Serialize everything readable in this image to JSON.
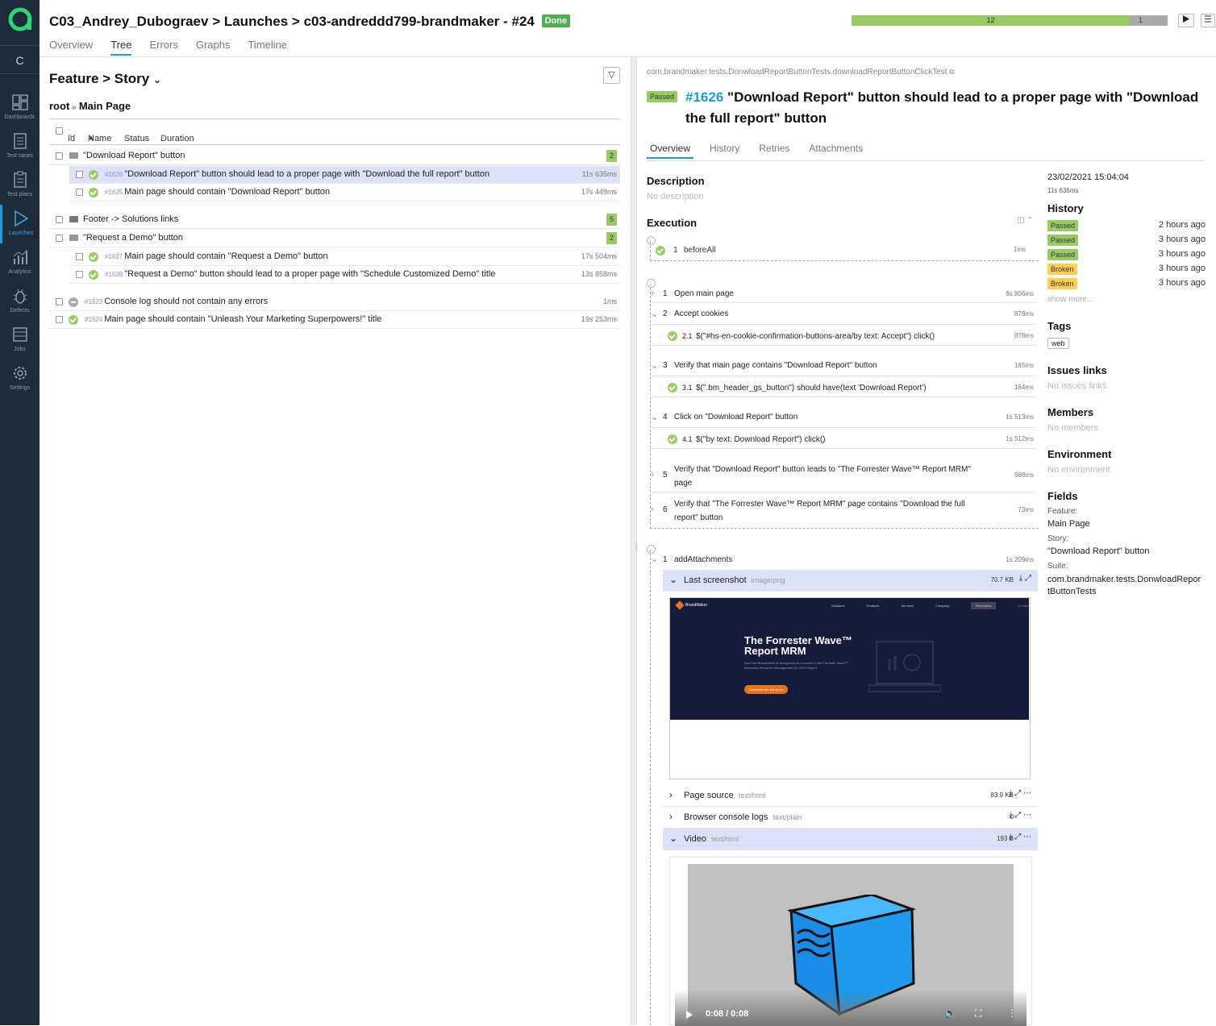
{
  "header": {
    "project": "C03_Andrey_Dubograev",
    "section": "Launches",
    "launch": "c03-andreddd799-brandmaker - #24",
    "status": "Done",
    "tabs": [
      "Overview",
      "Tree",
      "Errors",
      "Graphs",
      "Timeline"
    ],
    "active_tab": "Tree",
    "progress": {
      "passed": 12,
      "broken": 1,
      "passed_fraction": 0.88,
      "broken_fraction": 0.07
    }
  },
  "sidebar": {
    "c_button": "C",
    "items": [
      {
        "label": "Dashboards",
        "icon": "dashboard-icon"
      },
      {
        "label": "Test cases",
        "icon": "test-cases-icon"
      },
      {
        "label": "Test plans",
        "icon": "test-plans-icon"
      },
      {
        "label": "Launches",
        "icon": "launches-icon",
        "active": true
      },
      {
        "label": "Analytics",
        "icon": "analytics-icon"
      },
      {
        "label": "Defects",
        "icon": "bug-icon"
      },
      {
        "label": "Jobs",
        "icon": "jobs-icon"
      },
      {
        "label": "Settings",
        "icon": "gear-icon"
      }
    ]
  },
  "tree": {
    "grouping": "Feature > Story",
    "breadcrumb_root": "root",
    "breadcrumb_current": "Main Page",
    "columns": [
      "Id",
      "Name",
      "Status",
      "Duration"
    ],
    "rows": [
      {
        "type": "group",
        "name": "\"Download Report\" button",
        "count": "2"
      },
      {
        "type": "test",
        "id": "#1626",
        "name": "\"Download Report\" button should lead to a proper page with \"Download the full report\" button",
        "duration": "11s 635ms",
        "selected": true
      },
      {
        "type": "test",
        "id": "#1625",
        "name": "Main page should contain \"Download Report\" button",
        "duration": "17s 449ms"
      },
      {
        "type": "group",
        "name": "Footer -> Solutions links",
        "count": "5"
      },
      {
        "type": "group",
        "name": "\"Request a Demo\" button",
        "count": "2"
      },
      {
        "type": "test",
        "id": "#1627",
        "name": "Main page should contain \"Request a Demo\" button",
        "duration": "17s 504ms"
      },
      {
        "type": "test",
        "id": "#1628",
        "name": "\"Request a Demo\" button should lead to a proper page with \"Schedule Customized Demo\" title",
        "duration": "13s 858ms"
      },
      {
        "type": "test",
        "id": "#1623",
        "name": "Console log should not contain any errors",
        "duration": "1ms",
        "status": "skipped"
      },
      {
        "type": "test",
        "id": "#1624",
        "name": "Main page should contain \"Unleash Your Marketing Superpowers!\" title",
        "duration": "19s 253ms"
      }
    ]
  },
  "result": {
    "fullname": "com.brandmaker.tests.DonwloadReportButtonTests.downloadReportButtonClickTest",
    "status": "Passed",
    "id": "#1626",
    "title": "\"Download Report\" button should lead to a proper page with \"Download the full report\" button",
    "tabs": [
      "Overview",
      "History",
      "Retries",
      "Attachments"
    ],
    "active_tab": "Overview",
    "description_title": "Description",
    "description": "No description",
    "execution_title": "Execution",
    "before": {
      "n": "1",
      "name": "beforeAll",
      "duration": "1ms"
    },
    "steps": [
      {
        "n": "1",
        "name": "Open main page",
        "duration": "6s 806ms"
      },
      {
        "n": "2",
        "name": "Accept cookies",
        "duration": "878ms"
      },
      {
        "n": "2.1",
        "name": "$(\"#hs-en-cookie-confirmation-buttons-area/by text: Accept\") click()",
        "duration": "878ms"
      },
      {
        "n": "3",
        "name": "Verify that main page contains \"Download Report\" button",
        "duration": "165ms"
      },
      {
        "n": "3.1",
        "name": "$(\".bm_header_gs_button\") should have(text 'Download Report')",
        "duration": "164ms"
      },
      {
        "n": "4",
        "name": "Click on \"Download Report\" button",
        "duration": "1s 513ms"
      },
      {
        "n": "4.1",
        "name": "$(\"by text: Download Report\") click()",
        "duration": "1s 512ms"
      },
      {
        "n": "5",
        "name": "Verify that \"Download Report\" button leads to \"The Forrester Wave™ Report MRM\" page",
        "duration": "988ms"
      },
      {
        "n": "6",
        "name": "Verify that \"The Forrester Wave™ Report MRM\" page contains \"Download the full report\" button",
        "duration": "73ms"
      }
    ],
    "after": {
      "n": "1",
      "name": "addAttachments",
      "duration": "1s 209ms"
    },
    "attachments": [
      {
        "name": "Last screenshot",
        "mime": "image/png",
        "size": "70.7 KB"
      },
      {
        "name": "Page source",
        "mime": "text/html",
        "size": "83.9 KB"
      },
      {
        "name": "Browser console logs",
        "mime": "text/plain",
        "size": "0"
      },
      {
        "name": "Video",
        "mime": "text/html",
        "size": "193 B"
      }
    ],
    "screenshot": {
      "brand": "BrandMaker",
      "nav": [
        "Solutions",
        "Products",
        "Services",
        "Company",
        "Resources",
        "Contact"
      ],
      "heading1": "The Forrester Wave™",
      "heading2": "Report MRM",
      "body": "See how BrandMaker is recognized as a Leader in the Forrester Wave™ Marketing Resource Management Q1 2020 Report.",
      "cta": "Download the full report"
    },
    "video_time": "0:08 / 0:08"
  },
  "meta": {
    "date": "23/02/2021 15:04:04",
    "duration": "11s 635ms",
    "history_title": "History",
    "history": [
      {
        "status": "Passed",
        "ago": "2 hours ago",
        "color": "#97cc64"
      },
      {
        "status": "Passed",
        "ago": "3 hours ago",
        "color": "#97cc64"
      },
      {
        "status": "Passed",
        "ago": "3 hours ago",
        "color": "#97cc64"
      },
      {
        "status": "Broken",
        "ago": "3 hours ago",
        "color": "#ffd050"
      },
      {
        "status": "Broken",
        "ago": "3 hours ago",
        "color": "#ffd050"
      }
    ],
    "show_more": "show more...",
    "tags_title": "Tags",
    "tag": "web",
    "issues_title": "Issues links",
    "issues": "No issues links",
    "members_title": "Members",
    "members": "No members",
    "env_title": "Environment",
    "env": "No environment",
    "fields_title": "Fields",
    "feature_label": "Feature:",
    "feature": "Main Page",
    "story_label": "Story:",
    "story": "\"Download Report\" button",
    "suite_label": "Suite:",
    "suite1": "com.brandmaker.tests.DonwloadRepor",
    "suite2": "tButtonTests"
  },
  "colors": {
    "accent": "#1a9be0",
    "passed": "#97cc64",
    "broken": "#ffd050",
    "sidebar": "#1e2b3a"
  }
}
